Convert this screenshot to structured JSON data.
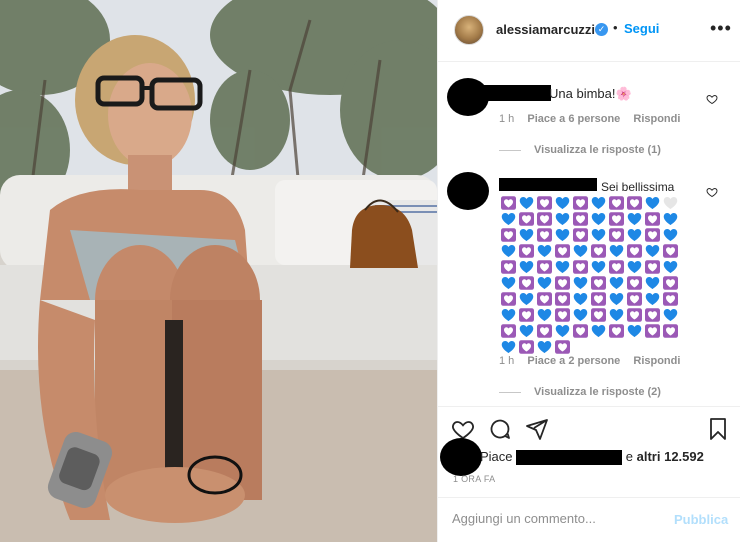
{
  "header": {
    "username": "alessiamarcuzzi",
    "verified_icon": "verified-badge-icon",
    "separator": "•",
    "follow_label": "Segui",
    "more_icon": "more-options-icon",
    "more_label": "•••"
  },
  "comments": [
    {
      "text": "Una bimba!🌸",
      "time": "1 h",
      "likes": "Piace a 6 persone",
      "reply": "Rispondi",
      "view_replies": "Visualizza le risposte (1)"
    },
    {
      "text": "Sei bellissima",
      "hearts": [
        "purple",
        "blue",
        "purple",
        "blue",
        "purple",
        "blue",
        "purple",
        "purple",
        "blue",
        "white",
        "blue",
        "purple",
        "purple",
        "blue",
        "purple",
        "blue",
        "purple",
        "blue",
        "purple",
        "blue",
        "purple",
        "blue",
        "purple",
        "blue",
        "purple",
        "blue",
        "purple",
        "blue",
        "purple",
        "blue",
        "blue",
        "purple",
        "blue",
        "purple",
        "blue",
        "purple",
        "blue",
        "purple",
        "blue",
        "purple",
        "purple",
        "blue",
        "purple",
        "blue",
        "purple",
        "blue",
        "purple",
        "blue",
        "purple",
        "blue",
        "blue",
        "purple",
        "blue",
        "purple",
        "blue",
        "purple",
        "blue",
        "purple",
        "blue",
        "purple",
        "purple",
        "blue",
        "purple",
        "purple",
        "blue",
        "purple",
        "blue",
        "purple",
        "blue",
        "purple",
        "blue",
        "purple",
        "blue",
        "purple",
        "blue",
        "purple",
        "blue",
        "purple",
        "purple",
        "blue",
        "purple",
        "blue",
        "purple",
        "blue",
        "purple",
        "blue",
        "purple",
        "blue",
        "purple",
        "purple",
        "blue",
        "purple",
        "blue",
        "purple"
      ],
      "time": "1 h",
      "likes": "Piace a 2 persone",
      "reply": "Rispondi",
      "view_replies": "Visualizza le risposte (2)"
    }
  ],
  "actions": {
    "like_icon": "heart-icon",
    "comment_icon": "comment-icon",
    "share_icon": "share-icon",
    "save_icon": "bookmark-icon"
  },
  "likes_line": {
    "prefix": "Piace",
    "suffix_and": "e",
    "others": "altri 12.592"
  },
  "timestamp": "1 ORA FA",
  "comment_input": {
    "placeholder": "Aggiungi un commento...",
    "publish_label": "Pubblica"
  },
  "colors": {
    "accent": "#0095f6",
    "publish_disabled": "#b2dffc",
    "heart_purple": "#9b59b6",
    "heart_blue": "#1e88e5"
  }
}
